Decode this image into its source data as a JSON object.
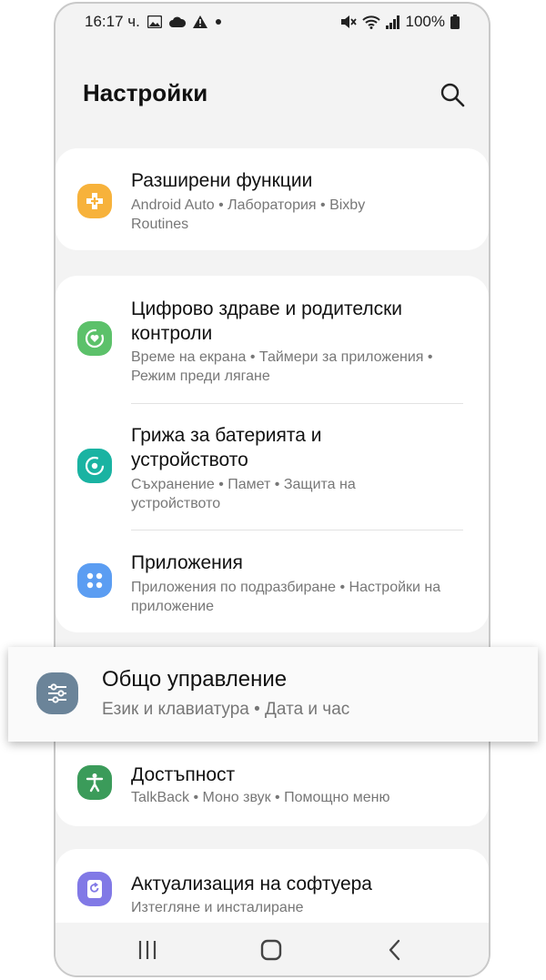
{
  "status": {
    "time": "16:17 ч.",
    "battery": "100%"
  },
  "page": {
    "title": "Настройки"
  },
  "items": [
    {
      "title": "Разширени функции",
      "subtitle": "Android Auto • Лаборатория • Bixby Routines",
      "icon": "plus-puzzle-icon",
      "color": "#f7b23b"
    },
    {
      "title": "Цифрово здраве и родителски контроли",
      "subtitle": "Време на екрана • Таймери за приложения • Режим преди лягане",
      "icon": "heart-ring-icon",
      "color": "#5cc16a"
    },
    {
      "title": "Грижа за батерията и устройството",
      "subtitle": "Съхранение • Памет • Защита на устройството",
      "icon": "device-care-icon",
      "color": "#1ab3a2"
    },
    {
      "title": "Приложения",
      "subtitle": "Приложения по подразбиране • Настройки на приложение",
      "icon": "apps-grid-icon",
      "color": "#5b9df2"
    },
    {
      "title": "Общо управление",
      "subtitle": "Език и клавиатура • Дата и час",
      "icon": "sliders-icon",
      "color": "#6b8499"
    },
    {
      "title": "Достъпност",
      "subtitle": "TalkBack • Моно звук • Помощно меню",
      "icon": "accessibility-icon",
      "color": "#3b9b5a"
    },
    {
      "title": "Актуализация на софтуера",
      "subtitle": "Изтегляне и инсталиране",
      "icon": "software-update-icon",
      "color": "#8179e6"
    }
  ]
}
